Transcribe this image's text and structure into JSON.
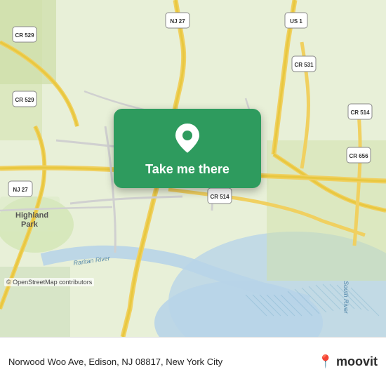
{
  "map": {
    "background_color": "#e8f0d8",
    "attribution": "© OpenStreetMap contributors"
  },
  "button": {
    "label": "Take me there",
    "pin_icon": "location-pin"
  },
  "bottom_bar": {
    "address": "Norwood Woo Ave, Edison, NJ 08817, New York City",
    "logo_text": "moovit",
    "logo_pin": "📍"
  },
  "road_labels": [
    "CR 529",
    "CR 529",
    "NJ 27",
    "US 1",
    "CR 531",
    "CR 514",
    "CR 656",
    "NJ 27",
    "CR 514",
    "Highland Park",
    "Raritan River"
  ]
}
